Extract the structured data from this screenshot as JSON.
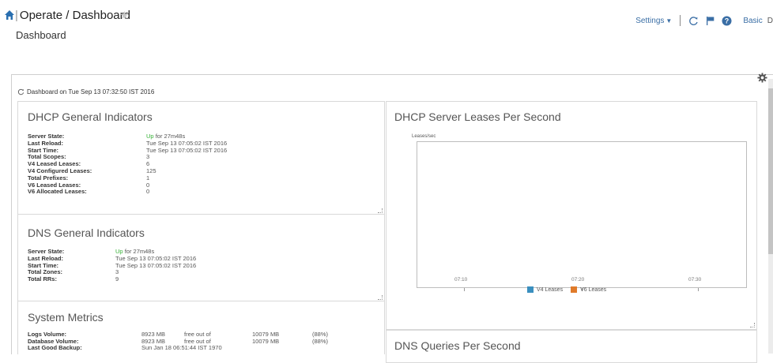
{
  "header": {
    "breadcrumb": "Operate / Dashboard",
    "subtitle": "Dashboard",
    "settings_label": "Settings",
    "mode_label": "Basic",
    "mode_extra": "D"
  },
  "dashboard": {
    "timestamp": "Dashboard on Tue Sep 13 07:32:50 IST 2016"
  },
  "dhcp": {
    "title": "DHCP General Indicators",
    "rows": [
      {
        "k": "Server State:",
        "v": "for 27m48s",
        "up": "Up"
      },
      {
        "k": "Last Reload:",
        "v": "Tue Sep 13 07:05:02 IST 2016"
      },
      {
        "k": "Start Time:",
        "v": "Tue Sep 13 07:05:02 IST 2016"
      },
      {
        "k": "Total Scopes:",
        "v": "3"
      },
      {
        "k": "V4 Leased Leases:",
        "v": "6"
      },
      {
        "k": "V4 Configured Leases:",
        "v": "125"
      },
      {
        "k": "Total Prefixes:",
        "v": "1"
      },
      {
        "k": "V6 Leased Leases:",
        "v": "0"
      },
      {
        "k": "V6 Allocated Leases:",
        "v": "0"
      }
    ]
  },
  "dns": {
    "title": "DNS General Indicators",
    "rows": [
      {
        "k": "Server State:",
        "v": "for 27m48s",
        "up": "Up"
      },
      {
        "k": "Last Reload:",
        "v": "Tue Sep 13 07:05:02 IST 2016"
      },
      {
        "k": "Start Time:",
        "v": "Tue Sep 13 07:05:02 IST 2016"
      },
      {
        "k": "Total Zones:",
        "v": "3"
      },
      {
        "k": "Total RRs:",
        "v": "9"
      }
    ]
  },
  "metrics": {
    "title": "System Metrics",
    "rows": [
      {
        "k": "Logs Volume:",
        "a": "8923 MB",
        "b": "free out of",
        "c": "10079 MB",
        "d": "(88%)"
      },
      {
        "k": "Database Volume:",
        "a": "8923 MB",
        "b": "free out of",
        "c": "10079 MB",
        "d": "(88%)"
      },
      {
        "k": "Last Good Backup:",
        "a": "Sun Jan 18 06:51:44 IST 1970",
        "b": "",
        "c": "",
        "d": ""
      }
    ]
  },
  "leases_chart": {
    "title": "DHCP Server Leases Per Second",
    "ylabel": "Leases/sec",
    "x_ticks": [
      "07:10",
      "07:20",
      "07:30"
    ],
    "legend": [
      "V4 Leases",
      "V6 Leases"
    ],
    "colors": {
      "v4": "#3a8fbf",
      "v6": "#e07b2a"
    }
  },
  "chart_data": {
    "type": "line",
    "title": "DHCP Server Leases Per Second",
    "ylabel": "Leases/sec",
    "xlabel": "",
    "categories": [
      "07:10",
      "07:20",
      "07:30"
    ],
    "series": [
      {
        "name": "V4 Leases",
        "values": []
      },
      {
        "name": "V6 Leases",
        "values": []
      }
    ],
    "legend_position": "bottom"
  },
  "dns_queries": {
    "title": "DNS Queries Per Second"
  },
  "icons": {
    "home": "home-icon",
    "star": "star-icon",
    "refresh": "refresh-icon",
    "flag": "flag-icon",
    "help": "help-icon",
    "gear": "gear-icon"
  }
}
